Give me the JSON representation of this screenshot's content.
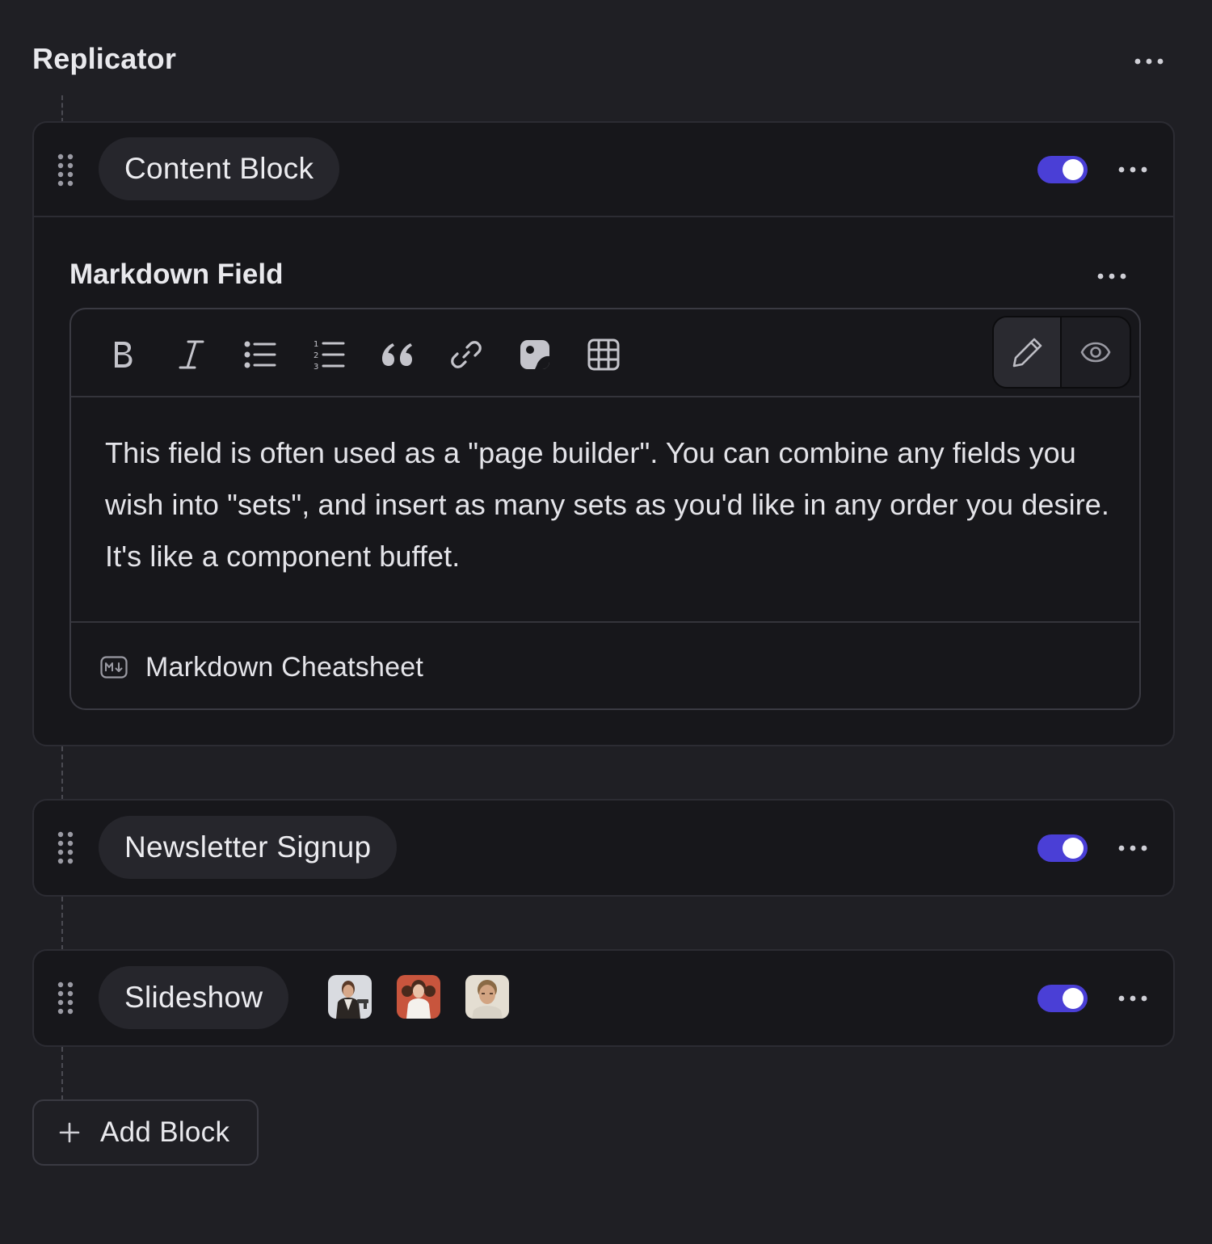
{
  "header": {
    "title": "Replicator",
    "menu_icon": "more-horizontal-icon"
  },
  "accent_color": "#4a3fd6",
  "blocks": [
    {
      "label": "Content Block",
      "enabled": true,
      "field": {
        "label": "Markdown Field",
        "toolbar": [
          "bold-icon",
          "italic-icon",
          "bullet-list-icon",
          "numbered-list-icon",
          "quote-icon",
          "link-icon",
          "image-icon",
          "table-icon"
        ],
        "modes": [
          "edit-pencil-icon",
          "preview-eye-icon"
        ],
        "active_mode": "edit",
        "content": "This field is often used as a \"page builder\". You can combine any fields you wish into \"sets\", and insert as many sets as you'd like in any order you desire. It's like a component buffet.",
        "cheatsheet_label": "Markdown Cheatsheet"
      }
    },
    {
      "label": "Newsletter Signup",
      "enabled": true
    },
    {
      "label": "Slideshow",
      "enabled": true,
      "thumbnails": [
        "portrait-thumbnail",
        "portrait-thumbnail",
        "portrait-thumbnail"
      ]
    }
  ],
  "add_block": {
    "label": "Add Block"
  }
}
